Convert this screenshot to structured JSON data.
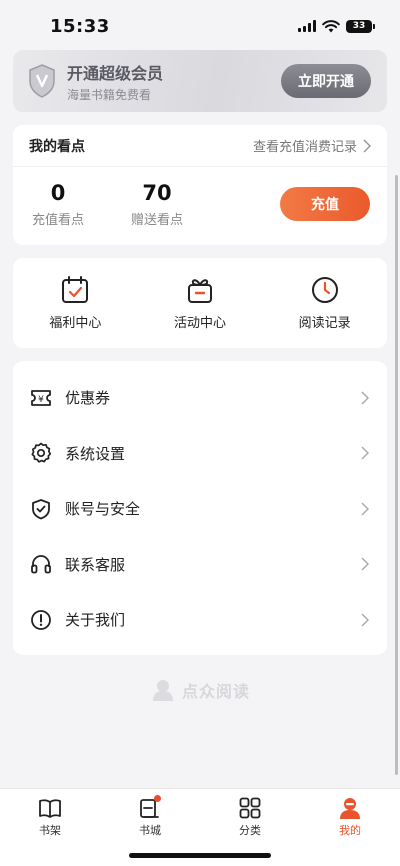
{
  "status_bar": {
    "time": "15:33",
    "battery": "33"
  },
  "vip": {
    "title": "开通超级会员",
    "subtitle": "海量书籍免费看",
    "button": "立即开通"
  },
  "points": {
    "title": "我的看点",
    "records_link": "查看充值消费记录",
    "recharge_points": {
      "value": "0",
      "label": "充值看点"
    },
    "gift_points": {
      "value": "70",
      "label": "赠送看点"
    },
    "recharge_button": "充值"
  },
  "quick_actions": [
    {
      "label": "福利中心",
      "icon": "calendar-check-icon"
    },
    {
      "label": "活动中心",
      "icon": "gift-icon"
    },
    {
      "label": "阅读记录",
      "icon": "clock-icon"
    }
  ],
  "menu": [
    {
      "label": "优惠券",
      "icon": "coupon-icon"
    },
    {
      "label": "系统设置",
      "icon": "gear-icon"
    },
    {
      "label": "账号与安全",
      "icon": "shield-icon"
    },
    {
      "label": "联系客服",
      "icon": "headphones-icon"
    },
    {
      "label": "关于我们",
      "icon": "info-icon"
    }
  ],
  "brand": {
    "name": "点众阅读"
  },
  "tabbar": [
    {
      "label": "书架",
      "icon": "book-icon",
      "active": false
    },
    {
      "label": "书城",
      "icon": "bookstore-icon",
      "active": false,
      "badge": true
    },
    {
      "label": "分类",
      "icon": "grid-icon",
      "active": false
    },
    {
      "label": "我的",
      "icon": "user-icon",
      "active": true
    }
  ],
  "colors": {
    "accent": "#e8542c",
    "background": "#f4f4f6"
  }
}
